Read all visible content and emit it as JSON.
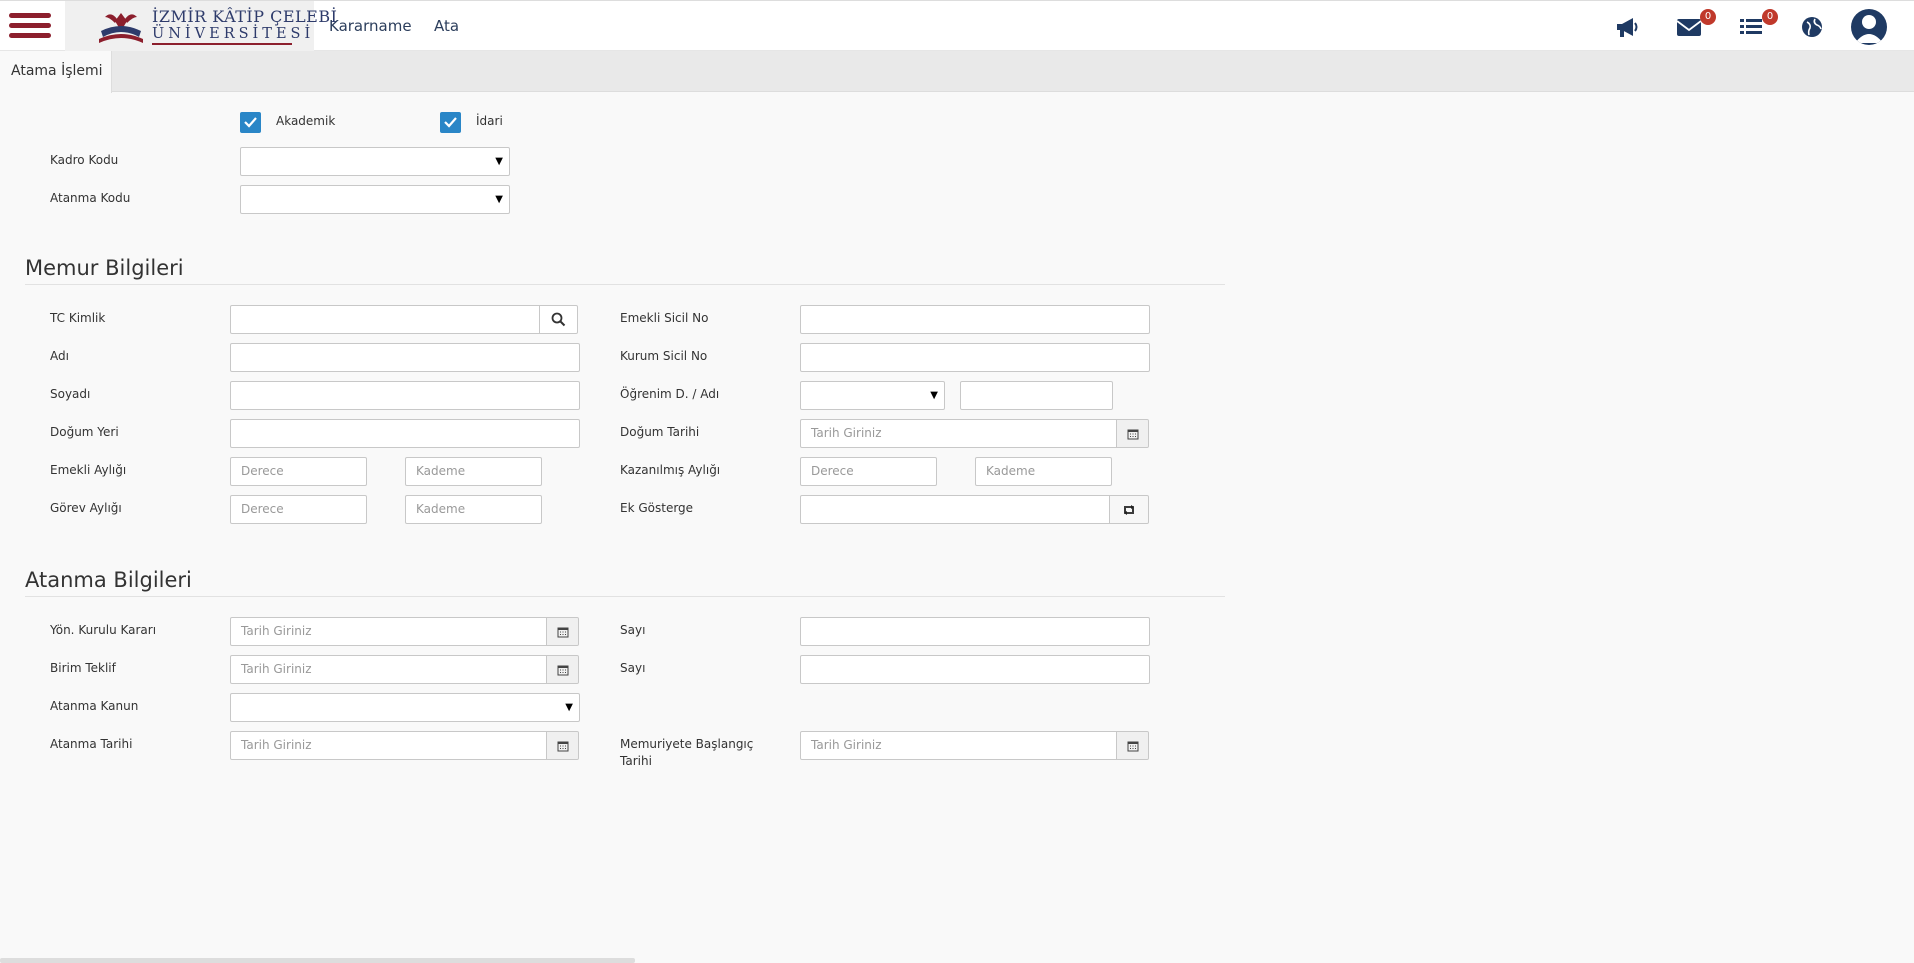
{
  "header": {
    "logo_line1": "İZMİR KÂTİP ÇELEBİ",
    "logo_line2": "ÜNİVERSİTESİ",
    "nav": [
      "Kararname",
      "Ata"
    ],
    "mail_badge": "0",
    "list_badge": "0",
    "icons": [
      "menu-icon",
      "megaphone-icon",
      "envelope-icon",
      "list-icon",
      "globe-icon",
      "user-icon"
    ]
  },
  "tabs": [
    "Atama İşlemi"
  ],
  "top_form": {
    "akademik_label": "Akademik",
    "idari_label": "İdari",
    "kadro_kodu_label": "Kadro Kodu",
    "atanma_kodu_label": "Atanma Kodu"
  },
  "memur": {
    "title": "Memur Bilgileri",
    "tc_kimlik": "TC Kimlik",
    "adi": "Adı",
    "soyadi": "Soyadı",
    "dogum_yeri": "Doğum Yeri",
    "emekli_ayligi": "Emekli Aylığı",
    "gorev_ayligi": "Görev Aylığı",
    "emekli_sicil_no": "Emekli Sicil No",
    "kurum_sicil_no": "Kurum Sicil No",
    "ogrenim": "Öğrenim D. / Adı",
    "dogum_tarihi": "Doğum Tarihi",
    "kazanilmis_ayligi": "Kazanılmış Aylığı",
    "ek_gosterge": "Ek Gösterge",
    "ph_date": "Tarih Giriniz",
    "ph_derece": "Derece",
    "ph_kademe": "Kademe"
  },
  "atanma": {
    "title": "Atanma Bilgileri",
    "yon_kurulu_karari": "Yön. Kurulu Kararı",
    "birim_teklif": "Birim Teklif",
    "atanma_kanun": "Atanma Kanun",
    "atanma_tarihi": "Atanma Tarihi",
    "sayi1": "Sayı",
    "sayi2": "Sayı",
    "memuriyete_baslangic_line1": "Memuriyete Başlangıç",
    "memuriyete_baslangic_line2": "Tarihi",
    "ph_date": "Tarih Giriniz"
  },
  "colors": {
    "brand": "#8c1f2d",
    "navy": "#1f3a63",
    "checkbox": "#2a86c7",
    "badge": "#c0392b"
  }
}
